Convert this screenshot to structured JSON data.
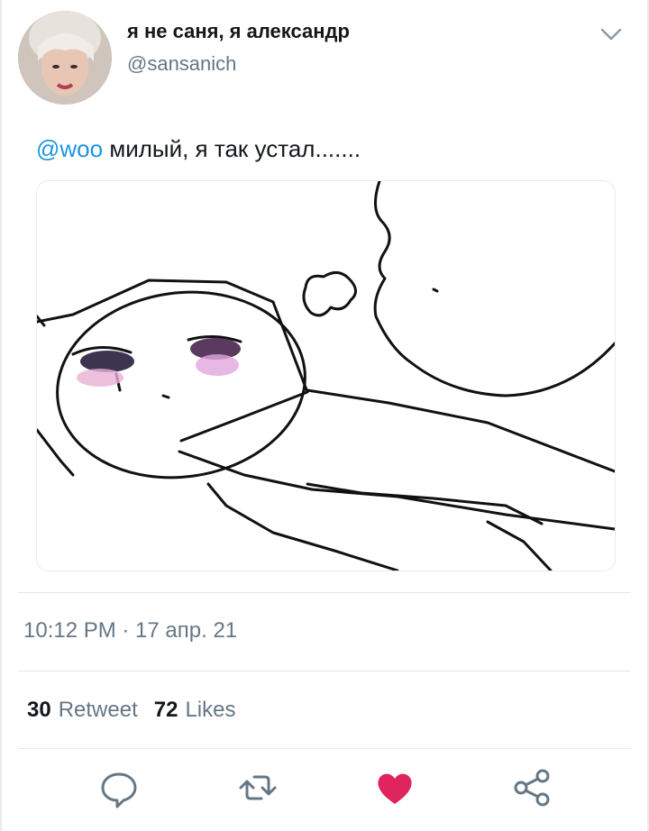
{
  "tweet": {
    "display_name": "я не саня, я александр",
    "handle": "@sansanich",
    "mention": "@woo",
    "body": " милый, я так устал.......",
    "timestamp": "10:12 PM · 17 апр. 21",
    "retweets_count": "30",
    "retweets_label": "Retweet",
    "likes_count": "72",
    "likes_label": "Likes"
  },
  "icons": {
    "menu": "chevron-down-icon",
    "reply": "reply-bubble-icon",
    "retweet": "retweet-icon",
    "like": "heart-icon",
    "share": "share-icon"
  },
  "colors": {
    "mention": "#1b95e0",
    "secondary_text": "#657786",
    "like_active": "#e0245e"
  }
}
